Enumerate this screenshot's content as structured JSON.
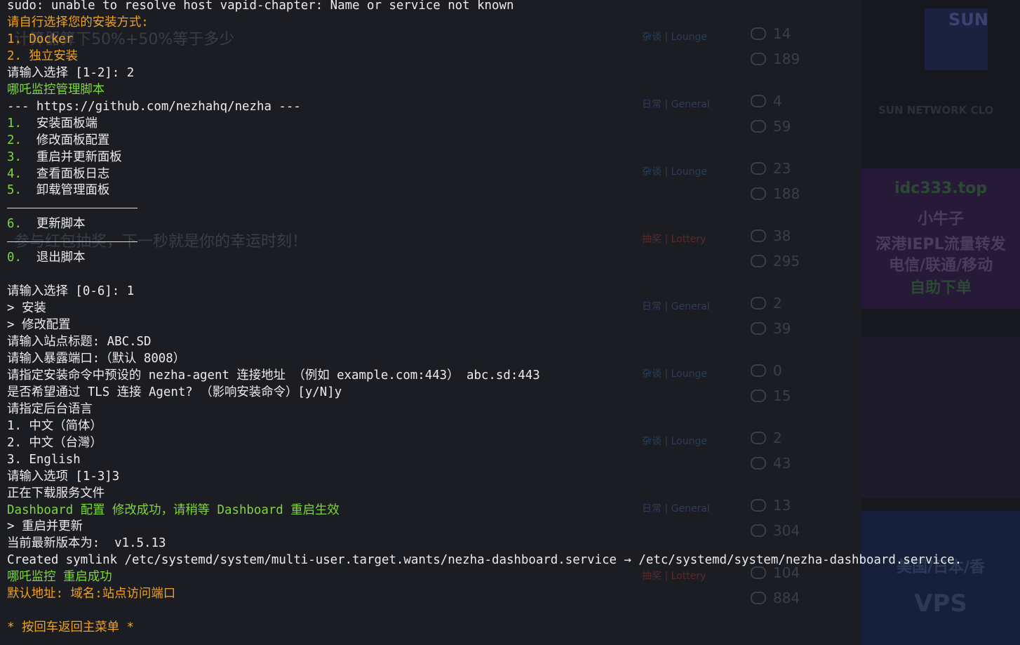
{
  "background": {
    "forum_rows": [
      {
        "title": "计算器算下50%+50%等于多少",
        "category": "杂谈 | Lounge",
        "replies": "14",
        "views": "189"
      },
      {
        "title": "",
        "category": "日常 | General",
        "replies": "4",
        "views": "59"
      },
      {
        "title": "",
        "category": "杂谈 | Lounge",
        "replies": "23",
        "views": "188"
      },
      {
        "title": "参与红包抽奖，下一秒就是你的幸运时刻！",
        "category": "抽奖 | Lottery",
        "replies": "38",
        "views": "295"
      },
      {
        "title": "",
        "category": "日常 | General",
        "replies": "2",
        "views": "39"
      },
      {
        "title": "",
        "category": "杂谈 | Lounge",
        "replies": "0",
        "views": "15"
      },
      {
        "title": "",
        "category": "杂谈 | Lounge",
        "replies": "2",
        "views": "43"
      },
      {
        "title": "",
        "category": "日常 | General",
        "replies": "13",
        "views": "304"
      },
      {
        "title": "",
        "category": "抽奖 | Lottery",
        "replies": "104",
        "views": "884"
      }
    ],
    "sidebar": {
      "sun_logo": "SUN",
      "sun_network": "SUN NETWORK CLO",
      "ad1_lines": [
        "idc333.top",
        "小牛子",
        "深港IEPL流量转发",
        "电信/联通/移动",
        "自助下单"
      ],
      "ad3_lines": [
        "美国/日本/香",
        "VPS"
      ]
    }
  },
  "terminal": {
    "lines": [
      {
        "text": "sudo: unable to resolve host vapid-chapter: Name or service not known",
        "color": "white"
      },
      {
        "text": "请自行选择您的安装方式:",
        "color": "orange"
      },
      {
        "text": "1. Docker",
        "color": "orange"
      },
      {
        "text": "2. 独立安装",
        "color": "orange"
      },
      {
        "text": "请输入选择 [1-2]: 2",
        "color": "white"
      },
      {
        "text": "哪吒监控管理脚本",
        "color": "green"
      },
      {
        "text": "--- https://github.com/nezhahq/nezha ---",
        "color": "white"
      },
      {
        "num": "1.",
        "text": "  安装面板端"
      },
      {
        "num": "2.",
        "text": "  修改面板配置"
      },
      {
        "num": "3.",
        "text": "  重启并更新面板"
      },
      {
        "num": "4.",
        "text": "  查看面板日志"
      },
      {
        "num": "5.",
        "text": "  卸载管理面板"
      },
      {
        "separator": true
      },
      {
        "num": "6.",
        "text": "  更新脚本"
      },
      {
        "separator": true
      },
      {
        "num": "0.",
        "text": "  退出脚本"
      },
      {
        "text": "",
        "color": "white"
      },
      {
        "text": "请输入选择 [0-6]: 1",
        "color": "white"
      },
      {
        "text": "> 安装",
        "color": "white"
      },
      {
        "text": "> 修改配置",
        "color": "white"
      },
      {
        "text": "请输入站点标题: ABC.SD",
        "color": "white"
      },
      {
        "text": "请输入暴露端口:（默认 8008）",
        "color": "white"
      },
      {
        "text": "请指定安装命令中预设的 nezha-agent 连接地址 （例如 example.com:443） abc.sd:443",
        "color": "white"
      },
      {
        "text": "是否希望通过 TLS 连接 Agent? （影响安装命令）[y/N]y",
        "color": "white"
      },
      {
        "text": "请指定后台语言",
        "color": "white"
      },
      {
        "text": "1. 中文（简体）",
        "color": "white"
      },
      {
        "text": "2. 中文（台灣）",
        "color": "white"
      },
      {
        "text": "3. English",
        "color": "white"
      },
      {
        "text": "请输入选项 [1-3]3",
        "color": "white"
      },
      {
        "text": "正在下载服务文件",
        "color": "white"
      },
      {
        "text": "Dashboard 配置 修改成功，请稍等 Dashboard 重启生效",
        "color": "green"
      },
      {
        "text": "> 重启并更新",
        "color": "white"
      },
      {
        "text": "当前最新版本为:  v1.5.13",
        "color": "white"
      },
      {
        "text": "Created symlink /etc/systemd/system/multi-user.target.wants/nezha-dashboard.service → /etc/systemd/system/nezha-dashboard.service.",
        "color": "white"
      },
      {
        "text": "哪吒监控 重启成功",
        "color": "green"
      },
      {
        "text": "默认地址: 域名:站点访问端口",
        "color": "orange"
      },
      {
        "text": "",
        "color": "white"
      },
      {
        "text": "* 按回车返回主菜单 *",
        "color": "orange"
      }
    ]
  },
  "colors": {
    "white": "#ececec",
    "orange": "#f0a11d",
    "green": "#7fd53c",
    "background": "#181a20"
  }
}
